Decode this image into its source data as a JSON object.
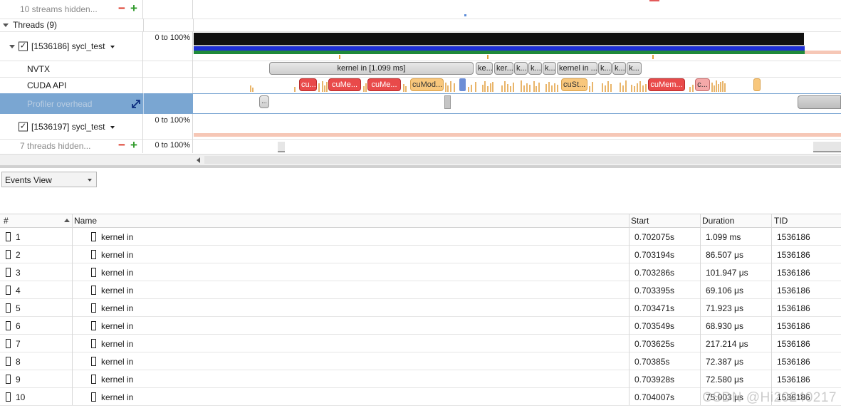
{
  "timeline": {
    "streams_hidden": "10 streams hidden...",
    "threads_group": "Threads (9)",
    "thread1": {
      "name": "[1536186] sycl_test",
      "scale": "0 to 100%",
      "checked": "✓"
    },
    "nvtx": {
      "label": "NVTX",
      "ranges": [
        "kernel in [1.099 ms]",
        "ke...",
        "ker...",
        "k...",
        "k...",
        "k...",
        "kernel in ...",
        "k...",
        "k...",
        "k..."
      ]
    },
    "cuda_api": {
      "label": "CUDA API",
      "calls": [
        "cu...",
        "cuMe...",
        "cuMe...",
        "cuMod...",
        "cuSt...",
        "cuMem...",
        "c..."
      ]
    },
    "profiler_overhead": {
      "label": "Profiler overhead",
      "marker": "..."
    },
    "thread2": {
      "name": "[1536197] sycl_test",
      "scale": "0 to 100%",
      "checked": "✓"
    },
    "threads_hidden": {
      "label": "7 threads hidden...",
      "scale": "0 to 100%"
    }
  },
  "events_view": {
    "selector": "Events View",
    "columns": [
      "#",
      "Name",
      "Start",
      "Duration",
      "TID"
    ],
    "rows": [
      {
        "n": "1",
        "name": "kernel in",
        "start": "0.702075s",
        "duration": "1.099 ms",
        "tid": "1536186"
      },
      {
        "n": "2",
        "name": "kernel in",
        "start": "0.703194s",
        "duration": "86.507 μs",
        "tid": "1536186"
      },
      {
        "n": "3",
        "name": "kernel in",
        "start": "0.703286s",
        "duration": "101.947 μs",
        "tid": "1536186"
      },
      {
        "n": "4",
        "name": "kernel in",
        "start": "0.703395s",
        "duration": "69.106 μs",
        "tid": "1536186"
      },
      {
        "n": "5",
        "name": "kernel in",
        "start": "0.703471s",
        "duration": "71.923 μs",
        "tid": "1536186"
      },
      {
        "n": "6",
        "name": "kernel in",
        "start": "0.703549s",
        "duration": "68.930 μs",
        "tid": "1536186"
      },
      {
        "n": "7",
        "name": "kernel in",
        "start": "0.703625s",
        "duration": "217.214 μs",
        "tid": "1536186"
      },
      {
        "n": "8",
        "name": "kernel in",
        "start": "0.70385s",
        "duration": "72.387 μs",
        "tid": "1536186"
      },
      {
        "n": "9",
        "name": "kernel in",
        "start": "0.703928s",
        "duration": "72.580 μs",
        "tid": "1536186"
      },
      {
        "n": "10",
        "name": "kernel in",
        "start": "0.704007s",
        "duration": "75.003 μs",
        "tid": "1536186"
      }
    ]
  },
  "watermark": "CSDN @Hi20240217",
  "colors": {
    "selected_row": "#7aa6d2",
    "cuda_red": "#e94a4a",
    "cuda_orange": "#f8c77c",
    "thread_bar_black": "#111111",
    "thread_bar_blue": "#1d2fd6",
    "thread_bar_green": "#1f8a3a"
  }
}
